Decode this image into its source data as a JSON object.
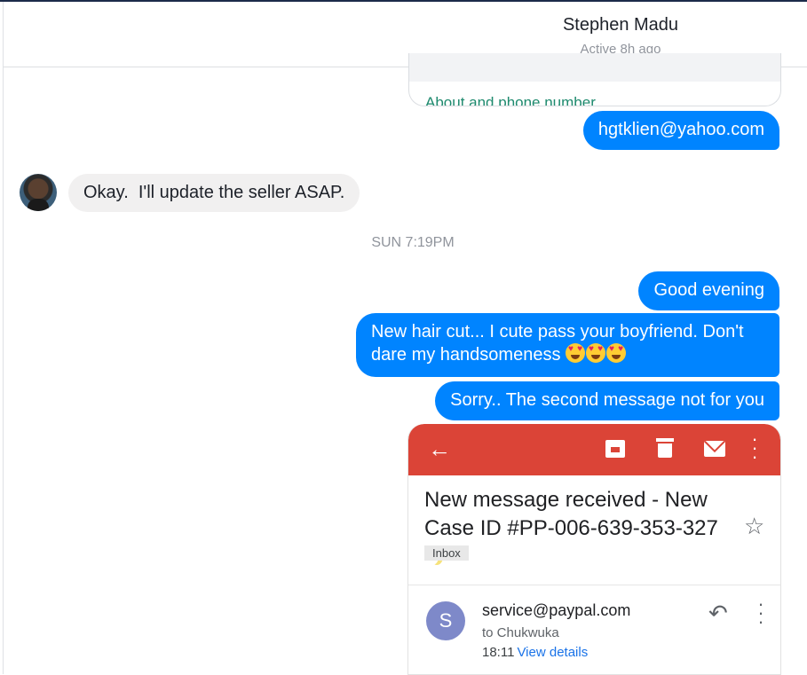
{
  "header": {
    "name": "Stephen Madu",
    "status": "Active 8h ago"
  },
  "messages": {
    "prev_card_link": "About and phone number",
    "email": "hgtklien@yahoo.com",
    "okay": "Okay.  I'll update the seller ASAP.",
    "timestamp": "SUN 7:19PM",
    "evening": "Good evening",
    "haircut": "New hair cut... I cute pass your boyfriend. Don't dare my handsomeness",
    "sorry": "Sorry.. The second message not for you"
  },
  "screenshot": {
    "subject": "New message received - New Case ID #PP-006-639-353-327",
    "label": "Inbox",
    "avatar_letter": "S",
    "sender": "service@paypal.com",
    "to": "to Chukwuka",
    "time": "18:11",
    "details_link": "View details",
    "bar_color": "#db4437",
    "icons": [
      "back-arrow-icon",
      "archive-icon",
      "trash-icon",
      "mail-icon",
      "more-vert-icon",
      "star-icon",
      "reply-icon"
    ]
  },
  "colors": {
    "outgoing": "#0084ff",
    "incoming": "#f1f0f0"
  }
}
